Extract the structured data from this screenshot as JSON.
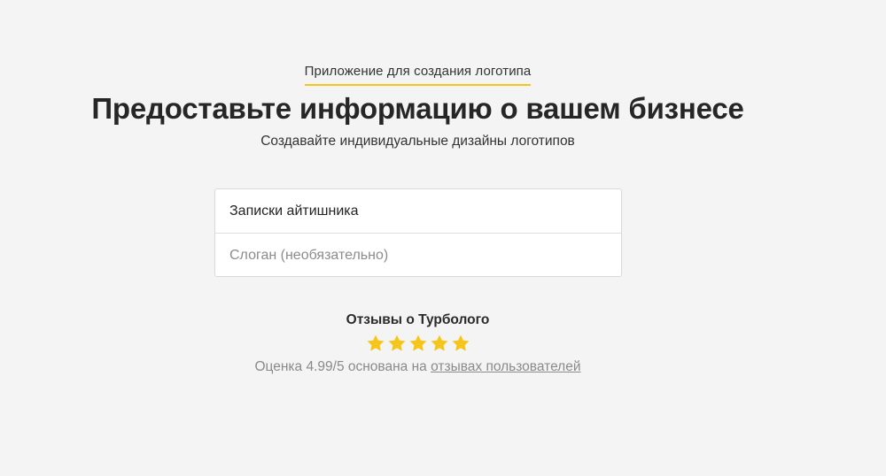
{
  "header": {
    "eyebrow": "Приложение для создания логотипа",
    "title": "Предоставьте информацию о вашем бизнесе",
    "subtitle": "Создавайте индивидуальные дизайны логотипов"
  },
  "form": {
    "business_name": {
      "value": "Записки айтишника",
      "placeholder": ""
    },
    "slogan": {
      "value": "",
      "placeholder": "Слоган (необязательно)"
    }
  },
  "reviews": {
    "title": "Отзывы о Турболого",
    "stars": 5,
    "star_color": "#f5c518",
    "rating_text": "Оценка 4.99/5 основана на",
    "link_text": "отзывах пользователей"
  },
  "colors": {
    "accent": "#f5c518",
    "background": "#f4f4f4"
  }
}
